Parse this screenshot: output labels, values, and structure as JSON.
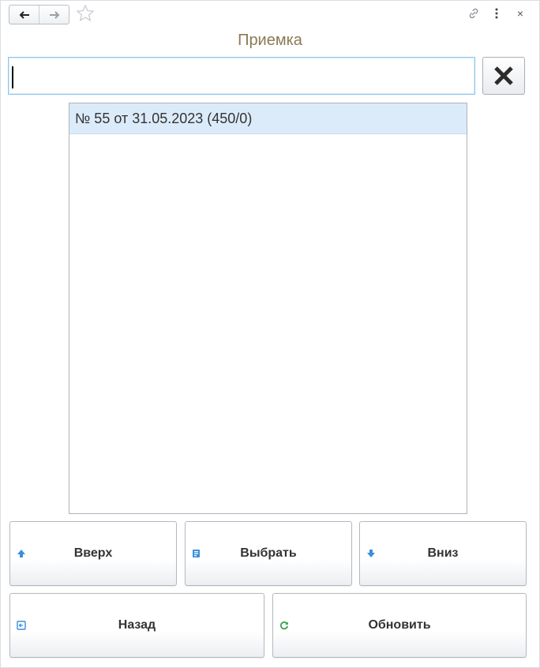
{
  "window": {
    "nav_back_icon": "arrow-left-icon",
    "nav_forward_icon": "arrow-right-icon",
    "favorite_icon": "star-icon",
    "link_icon": "link-icon",
    "menu_icon": "more-vertical-icon",
    "close_label": "×"
  },
  "title": "Приемка",
  "search": {
    "value": "",
    "placeholder": ""
  },
  "list": {
    "items": [
      {
        "label": "№ 55 от 31.05.2023 (450/0)",
        "selected": true
      }
    ]
  },
  "buttons": {
    "up": "Вверх",
    "select": "Выбрать",
    "down": "Вниз",
    "back": "Назад",
    "refresh": "Обновить"
  },
  "colors": {
    "title": "#8a7a55",
    "selection": "#dcebfa",
    "search_border": "#8fc7ec",
    "icon_blue": "#3b8fd9",
    "icon_green": "#3aa14a"
  }
}
